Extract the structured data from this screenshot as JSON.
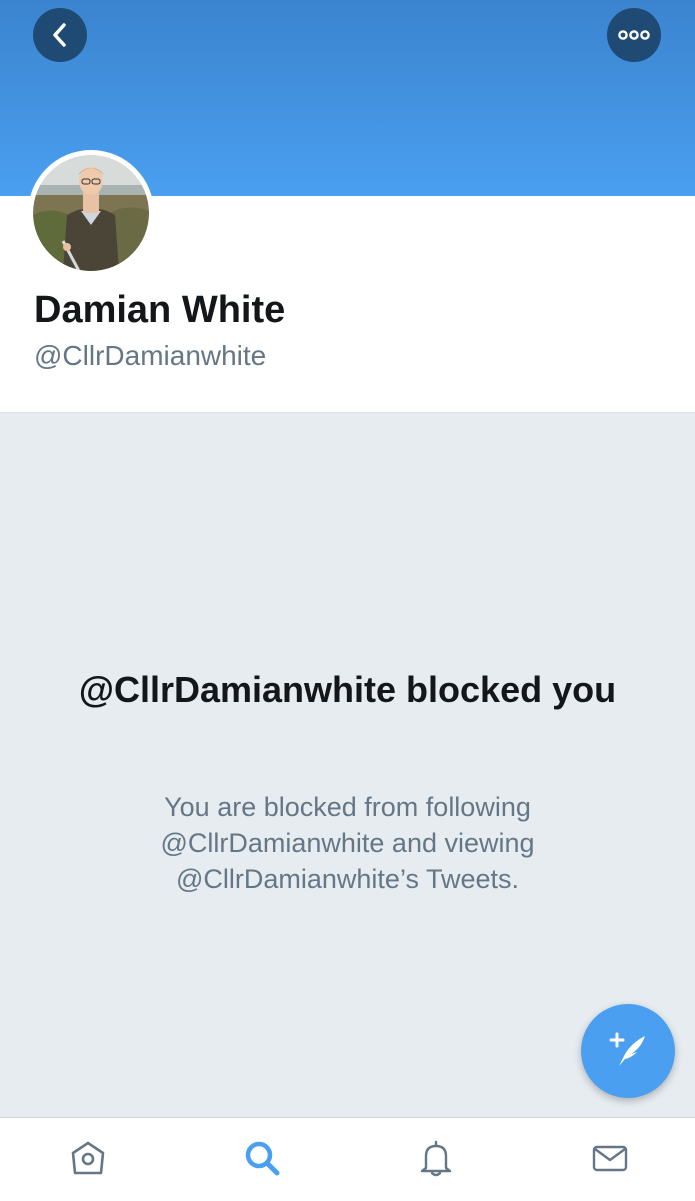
{
  "profile": {
    "display_name": "Damian White",
    "handle": "@CllrDamianwhite"
  },
  "blocked": {
    "title": "@CllrDamianwhite blocked you",
    "message": "You are blocked from following @CllrDamianwhite and viewing @CllrDamianwhite’s Tweets."
  },
  "icons": {
    "back": "chevron-left-icon",
    "more": "more-icon",
    "compose": "compose-tweet-icon",
    "home": "home-icon",
    "search": "search-icon",
    "notifications": "bell-icon",
    "messages": "mail-icon"
  },
  "colors": {
    "accent": "#4a9ff0",
    "banner_top": "#3b84cf",
    "button_dark": "#1f4a74",
    "text_primary": "#14171a",
    "text_secondary": "#657786",
    "blocked_bg": "#e6ecf0"
  }
}
